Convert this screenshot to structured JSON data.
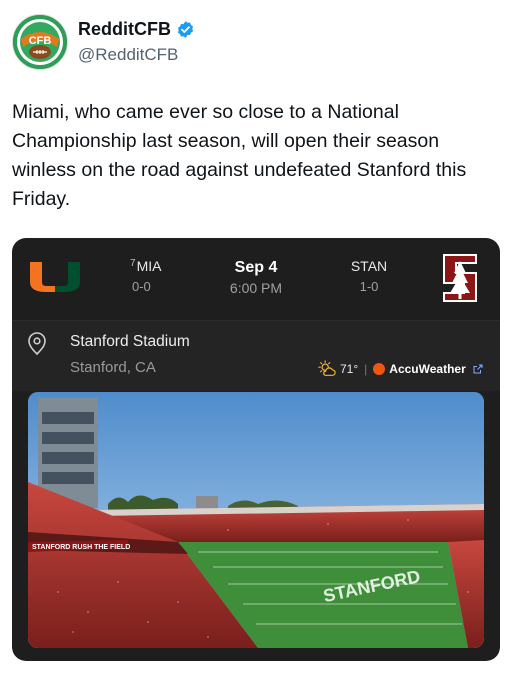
{
  "tweet": {
    "display_name": "RedditCFB",
    "handle": "@RedditCFB",
    "avatar_text": "CFB",
    "text": "Miami, who came ever so close to a National Championship last season, will open their season winless on the road against undefeated Stanford this Friday."
  },
  "game_card": {
    "away": {
      "rank": "7",
      "abbr": "MIA",
      "record": "0-0",
      "color": "#f47321",
      "color2": "#005030"
    },
    "date": "Sep 4",
    "time": "6:00 PM",
    "home": {
      "abbr": "STAN",
      "record": "1-0",
      "color": "#8c1515"
    },
    "venue": {
      "name": "Stanford Stadium",
      "city": "Stanford, CA"
    },
    "weather": {
      "temp": "71°",
      "separator": "|",
      "provider": "AccuWeather",
      "provider_color": "#f05514",
      "icon": "partly-sunny-icon"
    },
    "photo": {
      "end_zone_text": "STANFORD",
      "stand_banner": "STANFORD RUSH THE FIELD"
    }
  },
  "colors": {
    "verified": "#1d9bf0",
    "card_bg": "#1e1e1e",
    "field_green": "#3f8f3a"
  }
}
